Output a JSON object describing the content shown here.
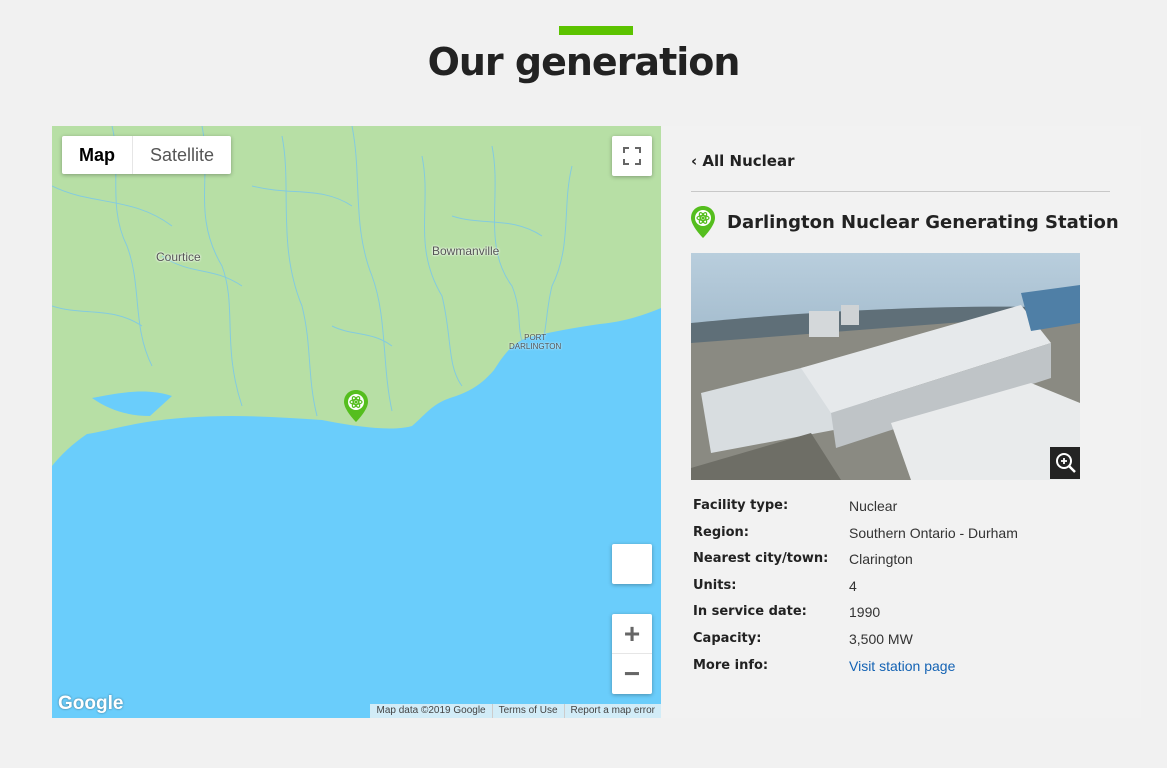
{
  "page": {
    "title": "Our generation",
    "accent_color": "#5cc300"
  },
  "map": {
    "type_control": {
      "map_label": "Map",
      "satellite_label": "Satellite",
      "selected": "Map"
    },
    "labels": {
      "courtice": "Courtice",
      "bowmanville": "Bowmanville",
      "port_line1": "PORT",
      "port_line2": "DARLINGTON"
    },
    "zoom_in": "+",
    "zoom_out": "−",
    "logo": "Google",
    "attribution": {
      "data": "Map data ©2019 Google",
      "terms": "Terms of Use",
      "report": "Report a map error"
    },
    "colors": {
      "land": "#b7dfa5",
      "water": "#6acdfb",
      "marker": "#55be1e"
    }
  },
  "panel": {
    "back_link": "‹ All Nuclear",
    "station_name": "Darlington Nuclear Generating Station",
    "facts": [
      {
        "label": "Facility type:",
        "value": "Nuclear"
      },
      {
        "label": "Region:",
        "value": "Southern Ontario - Durham"
      },
      {
        "label": "Nearest city/town:",
        "value": "Clarington"
      },
      {
        "label": "Units:",
        "value": "4"
      },
      {
        "label": "In service date:",
        "value": "1990"
      },
      {
        "label": "Capacity:",
        "value": "3,500 MW"
      },
      {
        "label": "More info:",
        "value": "Visit station page"
      }
    ],
    "link_color": "#1463b4"
  }
}
